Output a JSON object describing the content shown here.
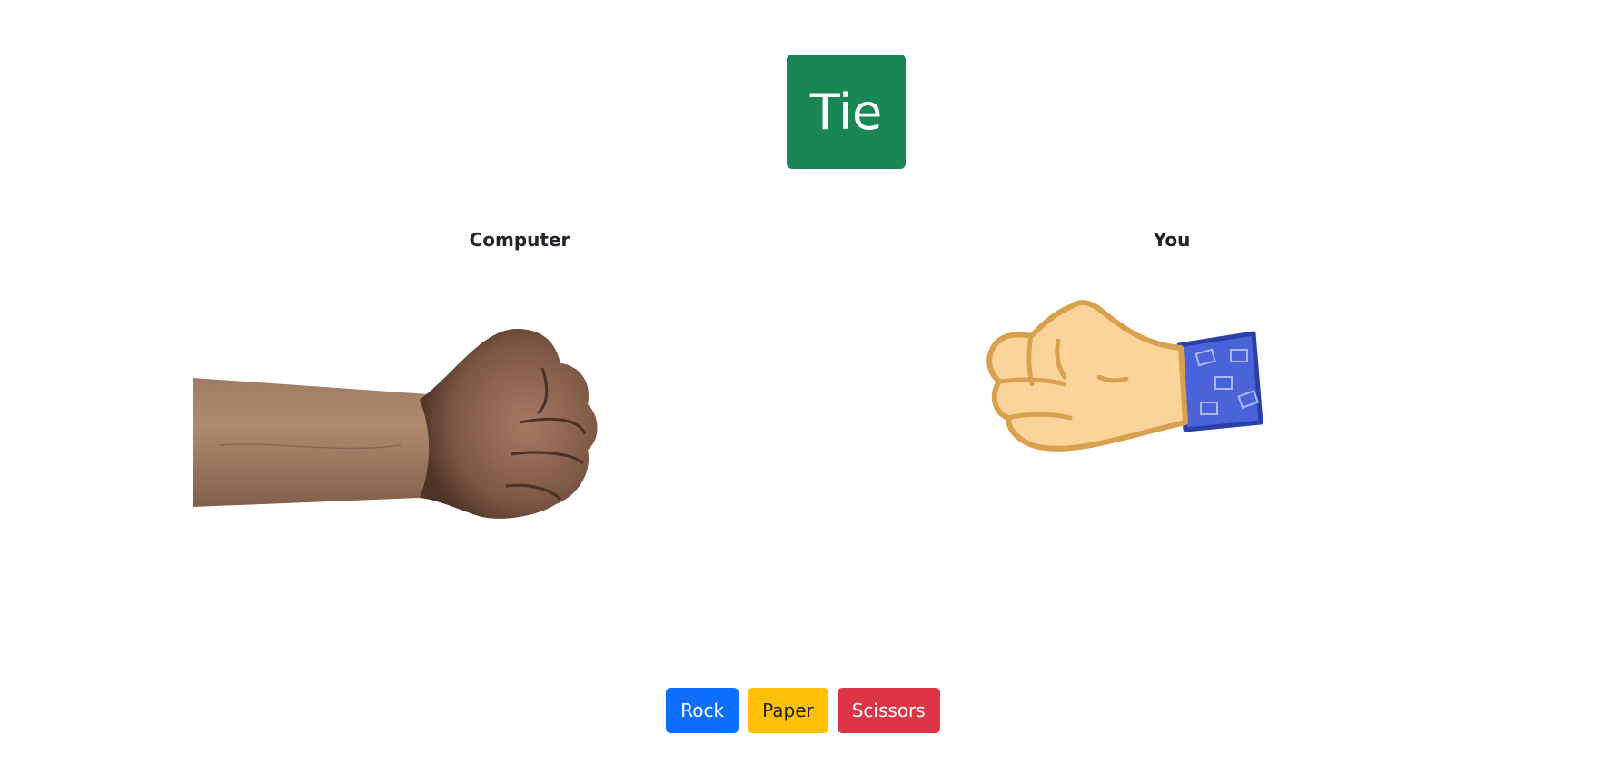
{
  "result": {
    "text": "Tie",
    "color": "#198754"
  },
  "players": {
    "computer": {
      "label": "Computer",
      "choice": "rock",
      "hand_icon": "realistic-fist"
    },
    "you": {
      "label": "You",
      "choice": "rock",
      "hand_icon": "cartoon-fist"
    }
  },
  "buttons": {
    "rock": {
      "label": "Rock",
      "color": "#0d6efd",
      "text_color": "#ffffff"
    },
    "paper": {
      "label": "Paper",
      "color": "#ffc107",
      "text_color": "#212529"
    },
    "scissors": {
      "label": "Scissors",
      "color": "#dc3545",
      "text_color": "#ffffff"
    }
  }
}
